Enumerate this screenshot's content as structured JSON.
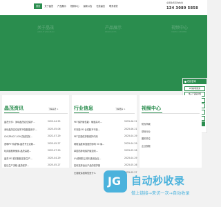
{
  "header": {
    "nav": [
      "首页",
      "关于晶茂",
      "产品展示",
      "视频中心",
      "最新公告",
      "在线留言",
      "联系我们"
    ],
    "hotline_label": "全国免费咨询热线",
    "hotline_number": "134 3089 5858"
  },
  "banner": {
    "titles": [
      "关于晶茂",
      "产品展示",
      "视频中心"
    ],
    "lines": [
      "ABOUT JINGMAO",
      "PRODUCTS",
      "VIDEO CENTER"
    ]
  },
  "side_panel": {
    "title": "在线咨询",
    "items": [
      "PE保护膜现货",
      "电子产品保护膜",
      "防刮保护膜",
      "防静电保护膜",
      "透明保护膜",
      "低粘保护膜",
      "单层自粘保护膜"
    ]
  },
  "cards": {
    "news": {
      "title": "晶茂资讯",
      "more": "了解晶茂 >",
      "rows": [
        {
          "text": "晶茂分享：深圳晶茂定位保护...",
          "date": "2025-04-25"
        },
        {
          "text": "深圳晶茂定位贴牢环保膜能用于...",
          "date": "2025-05-06"
        },
        {
          "text": "CM-ZR007-039 高粘性保...",
          "date": "2022-07-29"
        },
        {
          "text": "透明PET保护膜-晶茂专业定制...",
          "date": "2025-05-27"
        },
        {
          "text": "玩具膜推荐使用-晶茂高粘...",
          "date": "2022-07-29"
        },
        {
          "text": "晶茂 PE 模切胶膜定制生产...",
          "date": "2025-04-29"
        },
        {
          "text": "建议生产流程-晶茂保护...",
          "date": "2025-05-27"
        }
      ]
    },
    "industry": {
      "title": "行业信息",
      "more": "了解更多 >",
      "rows": [
        {
          "text": "PET保护膜性能：硬度高可...",
          "date": "2025-06-21"
        },
        {
          "text": "车衣膜 PE 合成膜不干胶...",
          "date": "2025-06-21"
        },
        {
          "text": "PET高透保护膜保护作用",
          "date": "2025-04-29"
        },
        {
          "text": "网络温度和湿度的影响 50 量...",
          "date": "2025-04-29"
        },
        {
          "text": "单层防静电保护膜如何...",
          "date": "2025-05-26"
        },
        {
          "text": "UV透明防尘材料选用及应...",
          "date": "2025-04-29"
        },
        {
          "text": "如何选择适合产品的保护膜",
          "date": "2025-05-26"
        },
        {
          "text": "无溶胶涂层特性是什么",
          "date": "2025-05-27"
        }
      ]
    },
    "video": {
      "title": "视频中心",
      "rows": [
        "防伪商城",
        "帮利行业",
        "图形单位",
        "企业视频"
      ]
    }
  },
  "watermark": {
    "logo": "JG",
    "title": "自动秒收录",
    "subtitle": "做上链接→来访一次→自动收录"
  },
  "colors": {
    "brand": "#2a8d4e",
    "watermark": "#2fa7d9"
  }
}
